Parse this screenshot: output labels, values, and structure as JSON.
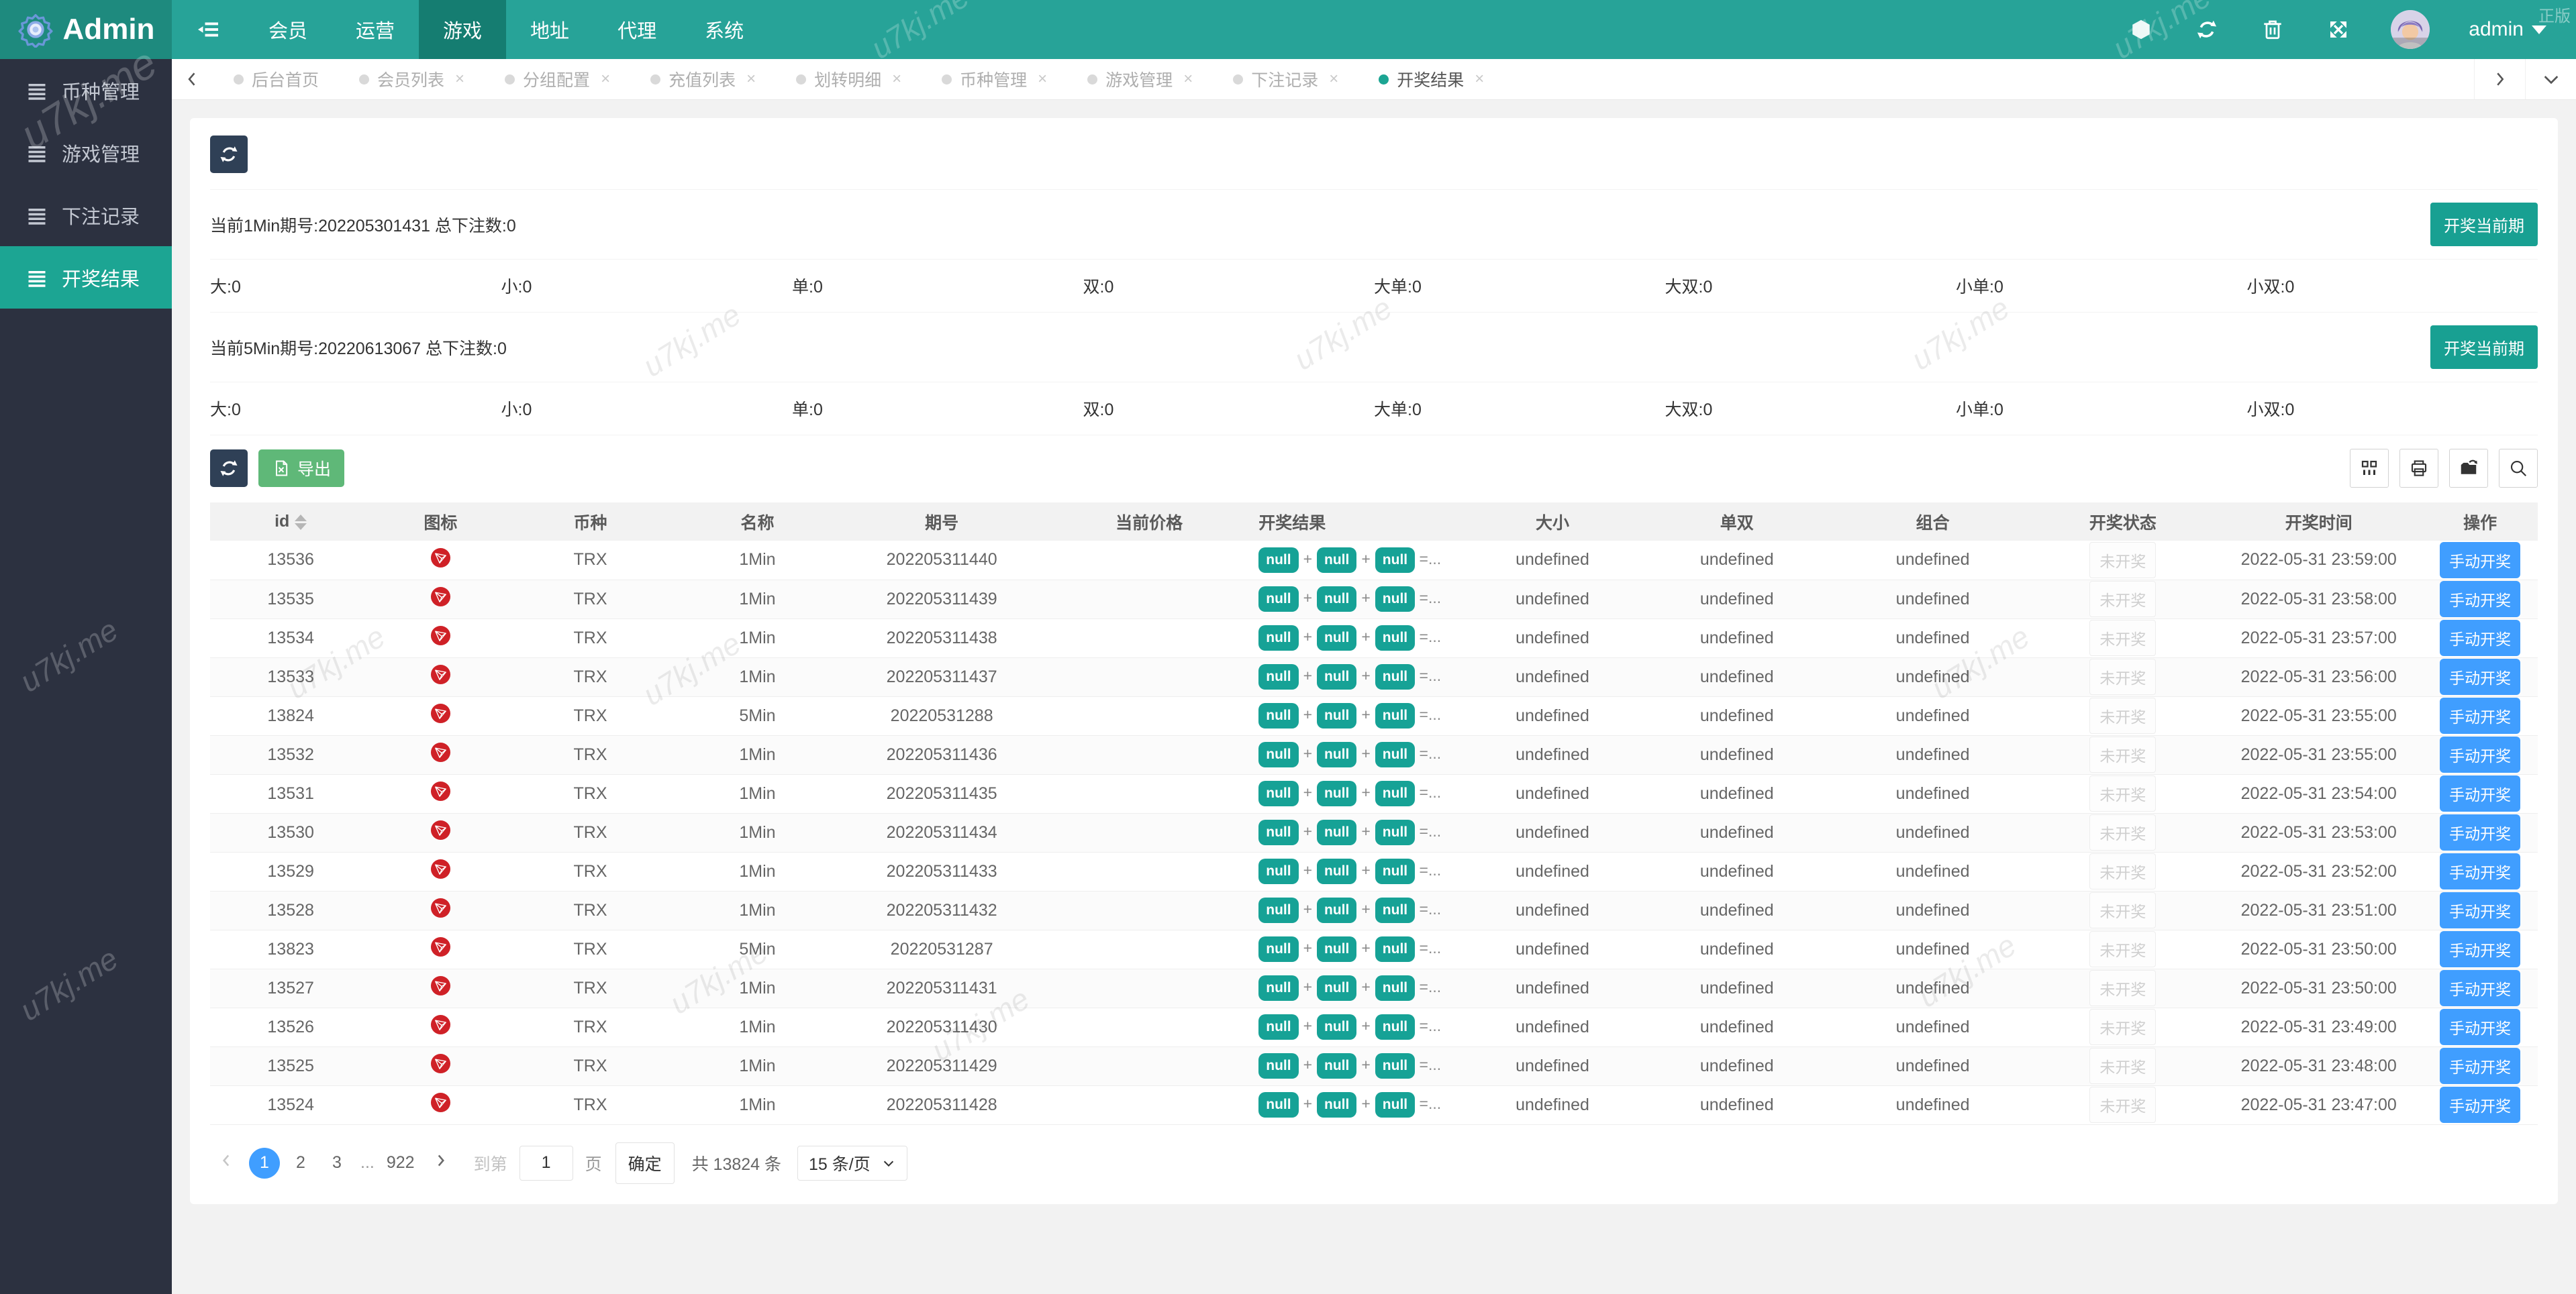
{
  "navbar": {
    "brand": "Admin",
    "menu": [
      {
        "label": "会员",
        "active": false
      },
      {
        "label": "运营",
        "active": false
      },
      {
        "label": "游戏",
        "active": true
      },
      {
        "label": "地址",
        "active": false
      },
      {
        "label": "代理",
        "active": false
      },
      {
        "label": "系统",
        "active": false
      }
    ],
    "username": "admin"
  },
  "sidebar": {
    "items": [
      {
        "label": "币种管理",
        "active": false
      },
      {
        "label": "游戏管理",
        "active": false
      },
      {
        "label": "下注记录",
        "active": false
      },
      {
        "label": "开奖结果",
        "active": true
      }
    ]
  },
  "tabs": [
    {
      "label": "后台首页",
      "closable": false,
      "active": false
    },
    {
      "label": "会员列表",
      "closable": true,
      "active": false
    },
    {
      "label": "分组配置",
      "closable": true,
      "active": false
    },
    {
      "label": "充值列表",
      "closable": true,
      "active": false
    },
    {
      "label": "划转明细",
      "closable": true,
      "active": false
    },
    {
      "label": "币种管理",
      "closable": true,
      "active": false
    },
    {
      "label": "游戏管理",
      "closable": true,
      "active": false
    },
    {
      "label": "下注记录",
      "closable": true,
      "active": false
    },
    {
      "label": "开奖结果",
      "closable": true,
      "active": true
    }
  ],
  "panel": {
    "sections": [
      {
        "title": "当前1Min期号:202205301431 总下注数:0",
        "button": "开奖当前期",
        "stats": [
          "大:0",
          "小:0",
          "单:0",
          "双:0",
          "大单:0",
          "大双:0",
          "小单:0",
          "小双:0"
        ]
      },
      {
        "title": "当前5Min期号:20220613067 总下注数:0",
        "button": "开奖当前期",
        "stats": [
          "大:0",
          "小:0",
          "单:0",
          "双:0",
          "大单:0",
          "大双:0",
          "小单:0",
          "小双:0"
        ]
      }
    ],
    "export_label": "导出"
  },
  "table": {
    "columns": [
      "id",
      "图标",
      "币种",
      "名称",
      "期号",
      "当前价格",
      "开奖结果",
      "大小",
      "单双",
      "组合",
      "开奖状态",
      "开奖时间",
      "操作"
    ],
    "result_badges": [
      "null",
      "null",
      "null"
    ],
    "result_suffix": "=...",
    "rows": [
      {
        "id": "13536",
        "coin": "TRX",
        "name": "1Min",
        "issue": "202205311440",
        "price": "",
        "size": "undefined",
        "parity": "undefined",
        "combo": "undefined",
        "status": "未开奖",
        "time": "2022-05-31 23:59:00",
        "action": "手动开奖"
      },
      {
        "id": "13535",
        "coin": "TRX",
        "name": "1Min",
        "issue": "202205311439",
        "price": "",
        "size": "undefined",
        "parity": "undefined",
        "combo": "undefined",
        "status": "未开奖",
        "time": "2022-05-31 23:58:00",
        "action": "手动开奖"
      },
      {
        "id": "13534",
        "coin": "TRX",
        "name": "1Min",
        "issue": "202205311438",
        "price": "",
        "size": "undefined",
        "parity": "undefined",
        "combo": "undefined",
        "status": "未开奖",
        "time": "2022-05-31 23:57:00",
        "action": "手动开奖"
      },
      {
        "id": "13533",
        "coin": "TRX",
        "name": "1Min",
        "issue": "202205311437",
        "price": "",
        "size": "undefined",
        "parity": "undefined",
        "combo": "undefined",
        "status": "未开奖",
        "time": "2022-05-31 23:56:00",
        "action": "手动开奖"
      },
      {
        "id": "13824",
        "coin": "TRX",
        "name": "5Min",
        "issue": "20220531288",
        "price": "",
        "size": "undefined",
        "parity": "undefined",
        "combo": "undefined",
        "status": "未开奖",
        "time": "2022-05-31 23:55:00",
        "action": "手动开奖"
      },
      {
        "id": "13532",
        "coin": "TRX",
        "name": "1Min",
        "issue": "202205311436",
        "price": "",
        "size": "undefined",
        "parity": "undefined",
        "combo": "undefined",
        "status": "未开奖",
        "time": "2022-05-31 23:55:00",
        "action": "手动开奖"
      },
      {
        "id": "13531",
        "coin": "TRX",
        "name": "1Min",
        "issue": "202205311435",
        "price": "",
        "size": "undefined",
        "parity": "undefined",
        "combo": "undefined",
        "status": "未开奖",
        "time": "2022-05-31 23:54:00",
        "action": "手动开奖"
      },
      {
        "id": "13530",
        "coin": "TRX",
        "name": "1Min",
        "issue": "202205311434",
        "price": "",
        "size": "undefined",
        "parity": "undefined",
        "combo": "undefined",
        "status": "未开奖",
        "time": "2022-05-31 23:53:00",
        "action": "手动开奖"
      },
      {
        "id": "13529",
        "coin": "TRX",
        "name": "1Min",
        "issue": "202205311433",
        "price": "",
        "size": "undefined",
        "parity": "undefined",
        "combo": "undefined",
        "status": "未开奖",
        "time": "2022-05-31 23:52:00",
        "action": "手动开奖"
      },
      {
        "id": "13528",
        "coin": "TRX",
        "name": "1Min",
        "issue": "202205311432",
        "price": "",
        "size": "undefined",
        "parity": "undefined",
        "combo": "undefined",
        "status": "未开奖",
        "time": "2022-05-31 23:51:00",
        "action": "手动开奖"
      },
      {
        "id": "13823",
        "coin": "TRX",
        "name": "5Min",
        "issue": "20220531287",
        "price": "",
        "size": "undefined",
        "parity": "undefined",
        "combo": "undefined",
        "status": "未开奖",
        "time": "2022-05-31 23:50:00",
        "action": "手动开奖"
      },
      {
        "id": "13527",
        "coin": "TRX",
        "name": "1Min",
        "issue": "202205311431",
        "price": "",
        "size": "undefined",
        "parity": "undefined",
        "combo": "undefined",
        "status": "未开奖",
        "time": "2022-05-31 23:50:00",
        "action": "手动开奖"
      },
      {
        "id": "13526",
        "coin": "TRX",
        "name": "1Min",
        "issue": "202205311430",
        "price": "",
        "size": "undefined",
        "parity": "undefined",
        "combo": "undefined",
        "status": "未开奖",
        "time": "2022-05-31 23:49:00",
        "action": "手动开奖"
      },
      {
        "id": "13525",
        "coin": "TRX",
        "name": "1Min",
        "issue": "202205311429",
        "price": "",
        "size": "undefined",
        "parity": "undefined",
        "combo": "undefined",
        "status": "未开奖",
        "time": "2022-05-31 23:48:00",
        "action": "手动开奖"
      },
      {
        "id": "13524",
        "coin": "TRX",
        "name": "1Min",
        "issue": "202205311428",
        "price": "",
        "size": "undefined",
        "parity": "undefined",
        "combo": "undefined",
        "status": "未开奖",
        "time": "2022-05-31 23:47:00",
        "action": "手动开奖"
      }
    ]
  },
  "pagination": {
    "pages": [
      {
        "label": "1",
        "active": true
      },
      {
        "label": "2",
        "active": false
      },
      {
        "label": "3",
        "active": false
      },
      {
        "label": "...",
        "active": false,
        "dots": true
      },
      {
        "label": "922",
        "active": false
      }
    ],
    "jump_prefix": "到第",
    "jump_value": "1",
    "jump_suffix": "页",
    "confirm": "确定",
    "total": "共 13824 条",
    "page_size": "15 条/页"
  },
  "watermark": {
    "text": "u7kj.me",
    "corner": "正版"
  }
}
